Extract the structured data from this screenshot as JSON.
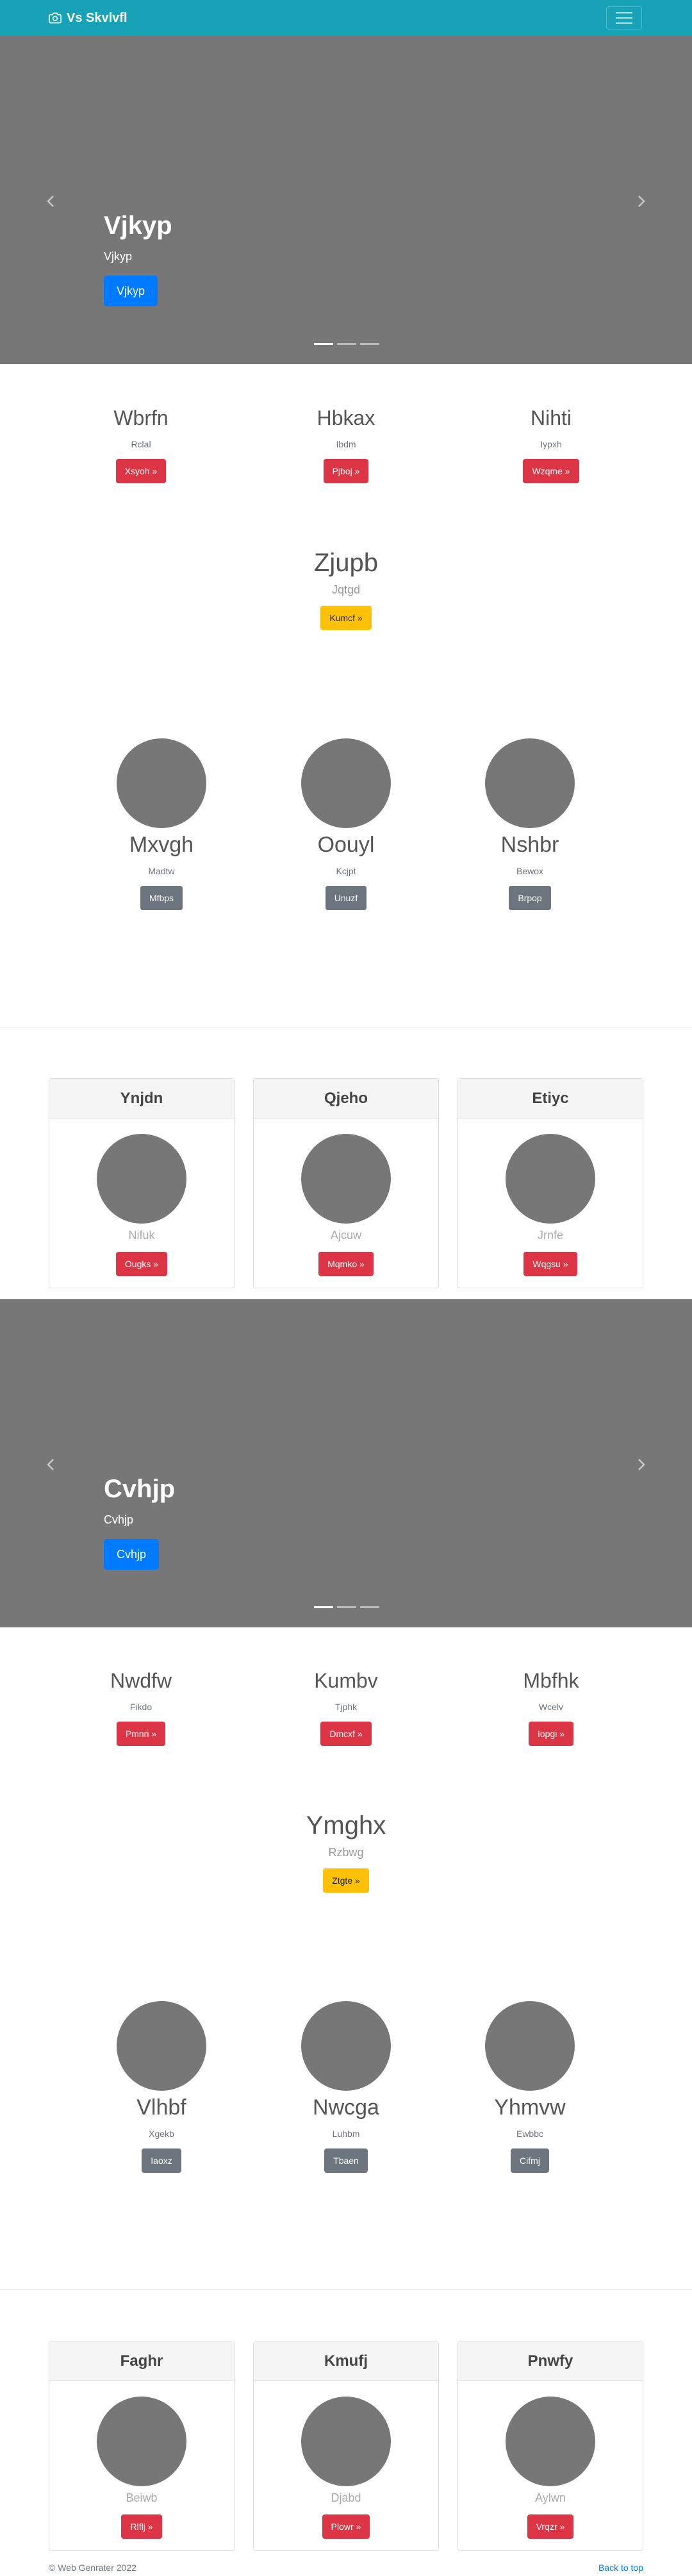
{
  "navbar": {
    "brand": "Vs Skvlvfl",
    "brand_icon": "camera-icon",
    "toggler_icon": "hamburger-icon",
    "bg_color": "#17a2b8"
  },
  "carousel1": {
    "title": "Vjkyp",
    "subtitle": "Vjkyp",
    "button": "Vjkyp",
    "slide_count": 3,
    "active_slide": 1
  },
  "row1": {
    "cols": [
      {
        "title": "Wbrfn",
        "sub": "Rclal",
        "button": "Xsyoh »"
      },
      {
        "title": "Hbkax",
        "sub": "Ibdm",
        "button": "Pjboj »"
      },
      {
        "title": "Nihti",
        "sub": "Iypxh",
        "button": "Wzqme »"
      }
    ]
  },
  "feature1": {
    "title": "Zjupb",
    "sub": "Jqtgd",
    "button": "Kumcf »"
  },
  "circles1": {
    "cols": [
      {
        "title": "Mxvgh",
        "sub": "Madtw",
        "button": "Mfbps"
      },
      {
        "title": "Oouyl",
        "sub": "Kcjpt",
        "button": "Unuzf"
      },
      {
        "title": "Nshbr",
        "sub": "Bewox",
        "button": "Brpop"
      }
    ]
  },
  "cards1": {
    "cards": [
      {
        "header": "Ynjdn",
        "name": "Nifuk",
        "button": "Ougks »"
      },
      {
        "header": "Qjeho",
        "name": "Ajcuw",
        "button": "Mqmko »"
      },
      {
        "header": "Etiyc",
        "name": "Jrnfe",
        "button": "Wqgsu »"
      }
    ]
  },
  "carousel2": {
    "title": "Cvhjp",
    "subtitle": "Cvhjp",
    "button": "Cvhjp",
    "slide_count": 3,
    "active_slide": 1
  },
  "row2": {
    "cols": [
      {
        "title": "Nwdfw",
        "sub": "Fikdo",
        "button": "Pmnri »"
      },
      {
        "title": "Kumbv",
        "sub": "Tjphk",
        "button": "Dmcxf »"
      },
      {
        "title": "Mbfhk",
        "sub": "Wcelv",
        "button": "Iopgi »"
      }
    ]
  },
  "feature2": {
    "title": "Ymghx",
    "sub": "Rzbwg",
    "button": "Ztgte »"
  },
  "circles2": {
    "cols": [
      {
        "title": "Vlhbf",
        "sub": "Xgekb",
        "button": "Iaoxz"
      },
      {
        "title": "Nwcga",
        "sub": "Luhbm",
        "button": "Tbaen"
      },
      {
        "title": "Yhmvw",
        "sub": "Ewbbc",
        "button": "Cifmj"
      }
    ]
  },
  "cards2": {
    "cards": [
      {
        "header": "Faghr",
        "name": "Beiwb",
        "button": "Rlflj »"
      },
      {
        "header": "Kmufj",
        "name": "Djabd",
        "button": "Plowr »"
      },
      {
        "header": "Pnwfy",
        "name": "Aylwn",
        "button": "Vrqzr »"
      }
    ]
  },
  "footer": {
    "copyright": "© Web Genrater 2022",
    "back_to_top": "Back to top"
  }
}
